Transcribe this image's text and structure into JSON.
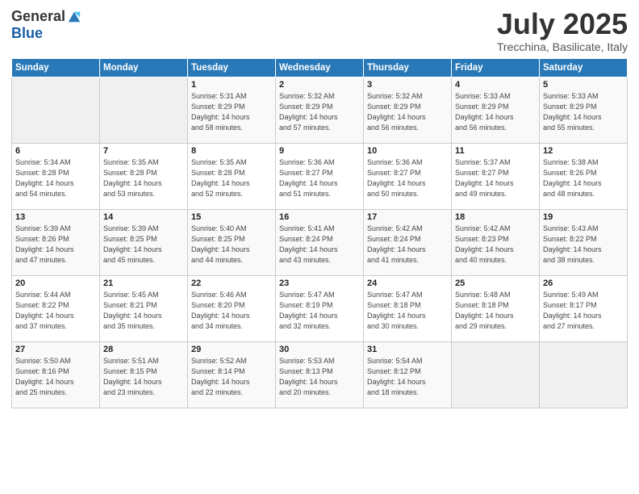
{
  "header": {
    "logo_general": "General",
    "logo_blue": "Blue",
    "month": "July 2025",
    "location": "Trecchina, Basilicate, Italy"
  },
  "weekdays": [
    "Sunday",
    "Monday",
    "Tuesday",
    "Wednesday",
    "Thursday",
    "Friday",
    "Saturday"
  ],
  "weeks": [
    [
      {
        "day": "",
        "info": ""
      },
      {
        "day": "",
        "info": ""
      },
      {
        "day": "1",
        "info": "Sunrise: 5:31 AM\nSunset: 8:29 PM\nDaylight: 14 hours\nand 58 minutes."
      },
      {
        "day": "2",
        "info": "Sunrise: 5:32 AM\nSunset: 8:29 PM\nDaylight: 14 hours\nand 57 minutes."
      },
      {
        "day": "3",
        "info": "Sunrise: 5:32 AM\nSunset: 8:29 PM\nDaylight: 14 hours\nand 56 minutes."
      },
      {
        "day": "4",
        "info": "Sunrise: 5:33 AM\nSunset: 8:29 PM\nDaylight: 14 hours\nand 56 minutes."
      },
      {
        "day": "5",
        "info": "Sunrise: 5:33 AM\nSunset: 8:29 PM\nDaylight: 14 hours\nand 55 minutes."
      }
    ],
    [
      {
        "day": "6",
        "info": "Sunrise: 5:34 AM\nSunset: 8:28 PM\nDaylight: 14 hours\nand 54 minutes."
      },
      {
        "day": "7",
        "info": "Sunrise: 5:35 AM\nSunset: 8:28 PM\nDaylight: 14 hours\nand 53 minutes."
      },
      {
        "day": "8",
        "info": "Sunrise: 5:35 AM\nSunset: 8:28 PM\nDaylight: 14 hours\nand 52 minutes."
      },
      {
        "day": "9",
        "info": "Sunrise: 5:36 AM\nSunset: 8:27 PM\nDaylight: 14 hours\nand 51 minutes."
      },
      {
        "day": "10",
        "info": "Sunrise: 5:36 AM\nSunset: 8:27 PM\nDaylight: 14 hours\nand 50 minutes."
      },
      {
        "day": "11",
        "info": "Sunrise: 5:37 AM\nSunset: 8:27 PM\nDaylight: 14 hours\nand 49 minutes."
      },
      {
        "day": "12",
        "info": "Sunrise: 5:38 AM\nSunset: 8:26 PM\nDaylight: 14 hours\nand 48 minutes."
      }
    ],
    [
      {
        "day": "13",
        "info": "Sunrise: 5:39 AM\nSunset: 8:26 PM\nDaylight: 14 hours\nand 47 minutes."
      },
      {
        "day": "14",
        "info": "Sunrise: 5:39 AM\nSunset: 8:25 PM\nDaylight: 14 hours\nand 45 minutes."
      },
      {
        "day": "15",
        "info": "Sunrise: 5:40 AM\nSunset: 8:25 PM\nDaylight: 14 hours\nand 44 minutes."
      },
      {
        "day": "16",
        "info": "Sunrise: 5:41 AM\nSunset: 8:24 PM\nDaylight: 14 hours\nand 43 minutes."
      },
      {
        "day": "17",
        "info": "Sunrise: 5:42 AM\nSunset: 8:24 PM\nDaylight: 14 hours\nand 41 minutes."
      },
      {
        "day": "18",
        "info": "Sunrise: 5:42 AM\nSunset: 8:23 PM\nDaylight: 14 hours\nand 40 minutes."
      },
      {
        "day": "19",
        "info": "Sunrise: 5:43 AM\nSunset: 8:22 PM\nDaylight: 14 hours\nand 38 minutes."
      }
    ],
    [
      {
        "day": "20",
        "info": "Sunrise: 5:44 AM\nSunset: 8:22 PM\nDaylight: 14 hours\nand 37 minutes."
      },
      {
        "day": "21",
        "info": "Sunrise: 5:45 AM\nSunset: 8:21 PM\nDaylight: 14 hours\nand 35 minutes."
      },
      {
        "day": "22",
        "info": "Sunrise: 5:46 AM\nSunset: 8:20 PM\nDaylight: 14 hours\nand 34 minutes."
      },
      {
        "day": "23",
        "info": "Sunrise: 5:47 AM\nSunset: 8:19 PM\nDaylight: 14 hours\nand 32 minutes."
      },
      {
        "day": "24",
        "info": "Sunrise: 5:47 AM\nSunset: 8:18 PM\nDaylight: 14 hours\nand 30 minutes."
      },
      {
        "day": "25",
        "info": "Sunrise: 5:48 AM\nSunset: 8:18 PM\nDaylight: 14 hours\nand 29 minutes."
      },
      {
        "day": "26",
        "info": "Sunrise: 5:49 AM\nSunset: 8:17 PM\nDaylight: 14 hours\nand 27 minutes."
      }
    ],
    [
      {
        "day": "27",
        "info": "Sunrise: 5:50 AM\nSunset: 8:16 PM\nDaylight: 14 hours\nand 25 minutes."
      },
      {
        "day": "28",
        "info": "Sunrise: 5:51 AM\nSunset: 8:15 PM\nDaylight: 14 hours\nand 23 minutes."
      },
      {
        "day": "29",
        "info": "Sunrise: 5:52 AM\nSunset: 8:14 PM\nDaylight: 14 hours\nand 22 minutes."
      },
      {
        "day": "30",
        "info": "Sunrise: 5:53 AM\nSunset: 8:13 PM\nDaylight: 14 hours\nand 20 minutes."
      },
      {
        "day": "31",
        "info": "Sunrise: 5:54 AM\nSunset: 8:12 PM\nDaylight: 14 hours\nand 18 minutes."
      },
      {
        "day": "",
        "info": ""
      },
      {
        "day": "",
        "info": ""
      }
    ]
  ]
}
